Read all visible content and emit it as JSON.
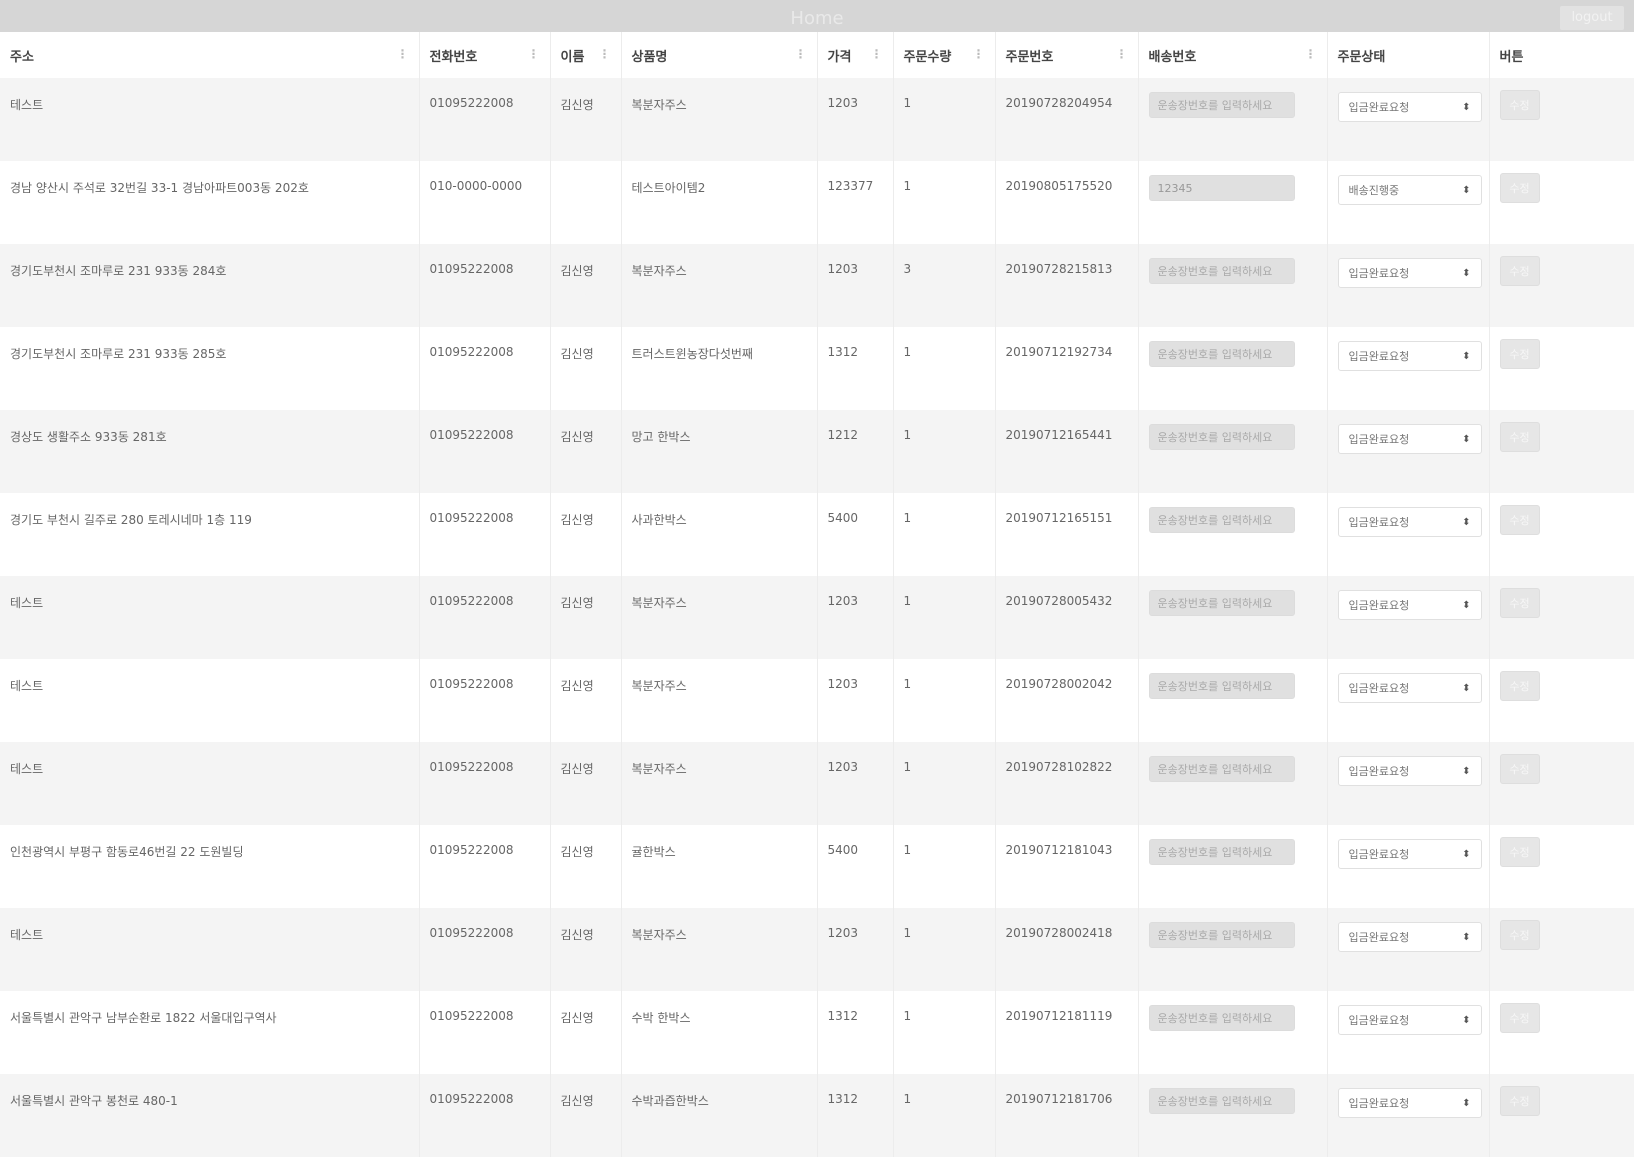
{
  "header": {
    "title": "Home",
    "logout_label": "logout"
  },
  "columns": [
    {
      "label": "주소",
      "sortable": true
    },
    {
      "label": "전화번호",
      "sortable": true
    },
    {
      "label": "이름",
      "sortable": true
    },
    {
      "label": "상품명",
      "sortable": true
    },
    {
      "label": "가격",
      "sortable": true
    },
    {
      "label": "주문수량",
      "sortable": true
    },
    {
      "label": "주문번호",
      "sortable": true
    },
    {
      "label": "배송번호",
      "sortable": true
    },
    {
      "label": "주문상태",
      "sortable": false
    },
    {
      "label": "버튼",
      "sortable": false
    }
  ],
  "ship_placeholder": "운송장번호를 입력하세요",
  "edit_label": "수정",
  "rows": [
    {
      "address": "테스트",
      "phone": "01095222008",
      "name": "김신영",
      "product": "복분자주스",
      "price": "1203",
      "qty": "1",
      "order_no": "20190728204954",
      "ship_no": "",
      "status": "입금완료요청"
    },
    {
      "address": "경남 양산시 주석로 32번길 33-1 경남아파트003동 202호",
      "phone": "010-0000-0000",
      "name": "",
      "product": "테스트아이템2",
      "price": "123377",
      "qty": "1",
      "order_no": "20190805175520",
      "ship_no": "12345",
      "status": "배송진행중"
    },
    {
      "address": "경기도부천시 조마루로 231 933동 284호",
      "phone": "01095222008",
      "name": "김신영",
      "product": "복분자주스",
      "price": "1203",
      "qty": "3",
      "order_no": "20190728215813",
      "ship_no": "",
      "status": "입금완료요청"
    },
    {
      "address": "경기도부천시 조마루로 231 933동 285호",
      "phone": "01095222008",
      "name": "김신영",
      "product": "트러스트윈농장다섯번째",
      "price": "1312",
      "qty": "1",
      "order_no": "20190712192734",
      "ship_no": "",
      "status": "입금완료요청"
    },
    {
      "address": "경상도 생활주소 933동 281호",
      "phone": "01095222008",
      "name": "김신영",
      "product": "망고 한박스",
      "price": "1212",
      "qty": "1",
      "order_no": "20190712165441",
      "ship_no": "",
      "status": "입금완료요청"
    },
    {
      "address": "경기도 부천시 길주로 280 토레시네마 1층 119",
      "phone": "01095222008",
      "name": "김신영",
      "product": "사과한박스",
      "price": "5400",
      "qty": "1",
      "order_no": "20190712165151",
      "ship_no": "",
      "status": "입금완료요청"
    },
    {
      "address": "테스트",
      "phone": "01095222008",
      "name": "김신영",
      "product": "복분자주스",
      "price": "1203",
      "qty": "1",
      "order_no": "20190728005432",
      "ship_no": "",
      "status": "입금완료요청"
    },
    {
      "address": "테스트",
      "phone": "01095222008",
      "name": "김신영",
      "product": "복분자주스",
      "price": "1203",
      "qty": "1",
      "order_no": "20190728002042",
      "ship_no": "",
      "status": "입금완료요청"
    },
    {
      "address": "테스트",
      "phone": "01095222008",
      "name": "김신영",
      "product": "복분자주스",
      "price": "1203",
      "qty": "1",
      "order_no": "20190728102822",
      "ship_no": "",
      "status": "입금완료요청"
    },
    {
      "address": "인천광역시 부평구 함동로46번길 22 도원빌딩",
      "phone": "01095222008",
      "name": "김신영",
      "product": "귤한박스",
      "price": "5400",
      "qty": "1",
      "order_no": "20190712181043",
      "ship_no": "",
      "status": "입금완료요청"
    },
    {
      "address": "테스트",
      "phone": "01095222008",
      "name": "김신영",
      "product": "복분자주스",
      "price": "1203",
      "qty": "1",
      "order_no": "20190728002418",
      "ship_no": "",
      "status": "입금완료요청"
    },
    {
      "address": "서울특별시 관악구 남부순환로 1822 서울대입구역사",
      "phone": "01095222008",
      "name": "김신영",
      "product": "수박 한박스",
      "price": "1312",
      "qty": "1",
      "order_no": "20190712181119",
      "ship_no": "",
      "status": "입금완료요청"
    },
    {
      "address": "서울특별시 관악구 봉천로 480-1",
      "phone": "01095222008",
      "name": "김신영",
      "product": "수박과즙한박스",
      "price": "1312",
      "qty": "1",
      "order_no": "20190712181706",
      "ship_no": "",
      "status": "입금완료요청"
    }
  ]
}
